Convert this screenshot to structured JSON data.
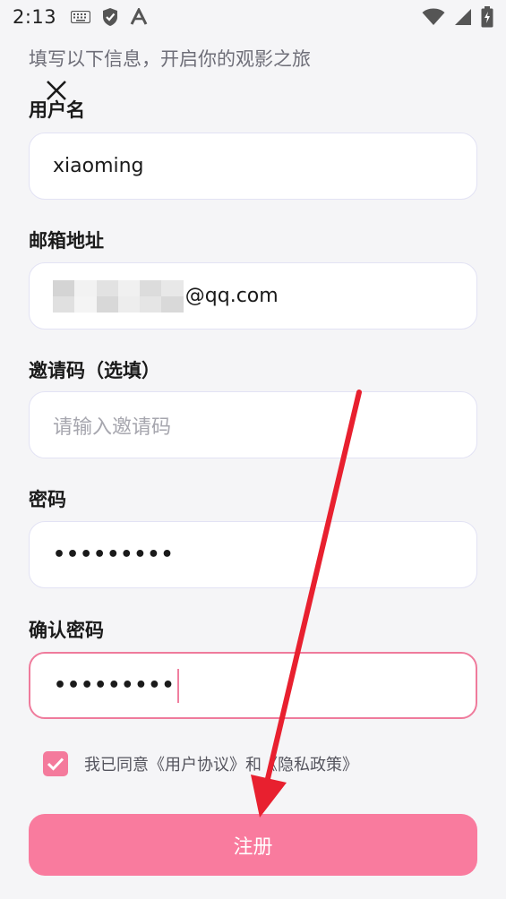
{
  "status_bar": {
    "time": "2:13",
    "left_icons": [
      "keyboard-icon",
      "shield-check-icon",
      "a-letter-icon"
    ],
    "right_icons": [
      "wifi-icon",
      "signal-icon",
      "battery-icon"
    ]
  },
  "header": {
    "subtitle": "填写以下信息，开启你的观影之旅",
    "close_icon": "close-icon"
  },
  "form": {
    "username": {
      "label": "用户名",
      "value": "xiaoming"
    },
    "email": {
      "label": "邮箱地址",
      "value_visible": "@qq.com"
    },
    "invite_code": {
      "label": "邀请码（选填）",
      "placeholder": "请输入邀请码"
    },
    "password": {
      "label": "密码",
      "value_masked": "•••••••••"
    },
    "confirm_password": {
      "label": "确认密码",
      "value_masked": "•••••••••"
    }
  },
  "agreement": {
    "checked": true,
    "text": "我已同意《用户协议》和《隐私政策》"
  },
  "submit": {
    "label": "注册"
  },
  "colors": {
    "accent": "#f97b9e",
    "focus_border": "#ef7b9c",
    "annotation_arrow": "#e8202f",
    "background": "#f5f5f7"
  }
}
